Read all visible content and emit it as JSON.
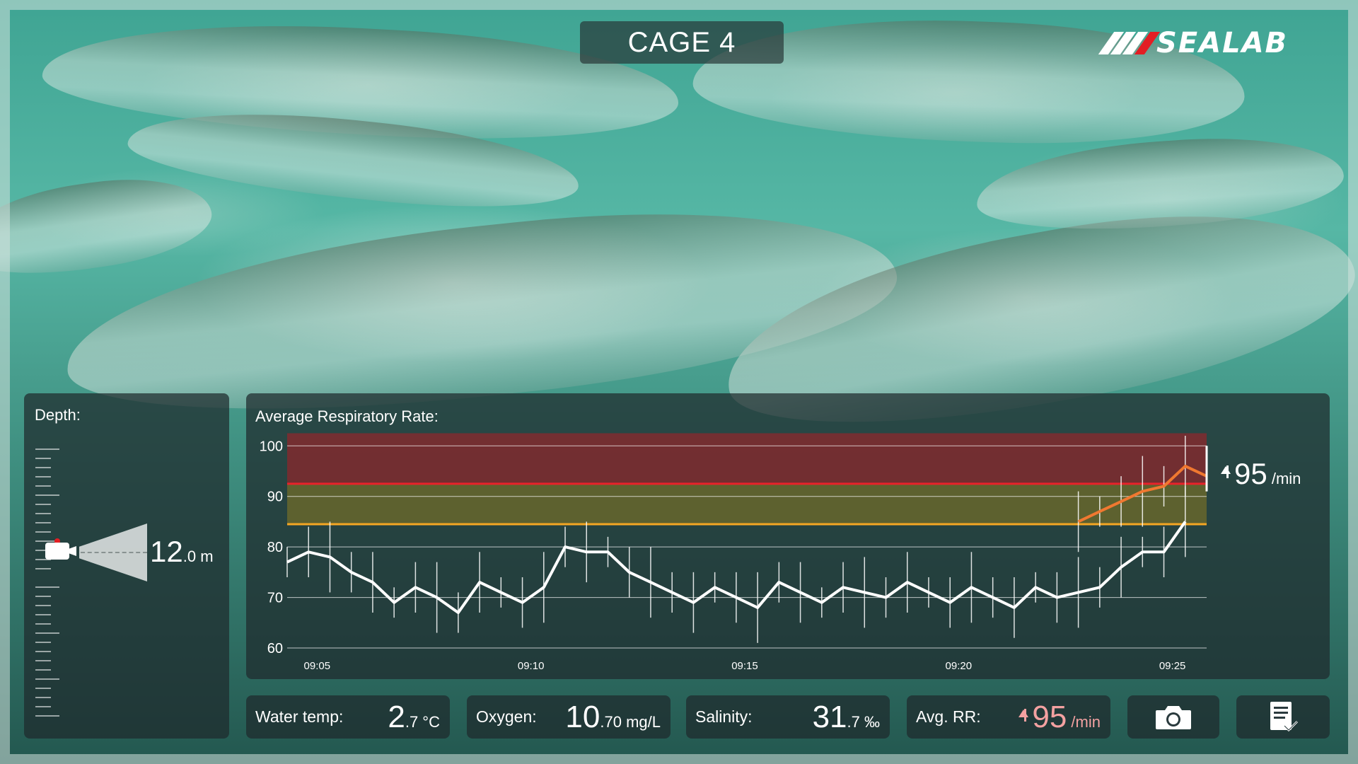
{
  "title": "CAGE 4",
  "brand": {
    "name": "SEALAB",
    "accent": "#e31e24"
  },
  "depth": {
    "label": "Depth:",
    "value_int": "12",
    "value_dec": ".0",
    "unit": " m",
    "camera_icon": "camera-icon"
  },
  "chart": {
    "title": "Average Respiratory Rate:",
    "current": {
      "value": "95",
      "unit": " /min"
    }
  },
  "chart_data": {
    "type": "line",
    "title": "Average Respiratory Rate:",
    "ylim": [
      60,
      102
    ],
    "yticks": [
      "60",
      "70",
      "80",
      "90",
      "100"
    ],
    "xticks": [
      "09:05",
      "09:10",
      "09:15",
      "09:20",
      "09:25"
    ],
    "xlim_minutes": [
      0,
      21.5
    ],
    "xtick_minutes": [
      0.7,
      5.7,
      10.7,
      15.7,
      20.7
    ],
    "thresholds": [
      {
        "name": "alarm",
        "value": 92.5,
        "color": "#e8232a"
      },
      {
        "name": "warning",
        "value": 84.5,
        "color": "#f5a623"
      }
    ],
    "bands": [
      {
        "from": 92.5,
        "to": 102.5,
        "color": "#b01b22"
      },
      {
        "from": 84.5,
        "to": 92.5,
        "color": "#8a7a20"
      }
    ],
    "grid": true,
    "series": [
      {
        "x": [
          0,
          0.5,
          1,
          1.5,
          2,
          2.5,
          3,
          3.5,
          4,
          4.5,
          5,
          5.5,
          6,
          6.5,
          7,
          7.5,
          8,
          8.5,
          9,
          9.5,
          10,
          10.5,
          11,
          11.5,
          12,
          12.5,
          13,
          13.5,
          14,
          14.5,
          15,
          15.5,
          16,
          16.5,
          17,
          17.5,
          18,
          18.5,
          19,
          19.5,
          20,
          20.5,
          21
        ],
        "values": [
          77,
          79,
          78,
          75,
          73,
          69,
          72,
          70,
          67,
          73,
          71,
          69,
          72,
          80,
          79,
          79,
          75,
          73,
          71,
          69,
          72,
          70,
          68,
          73,
          71,
          69,
          72,
          71,
          70,
          73,
          71,
          69,
          72,
          70,
          68,
          72,
          70,
          71,
          72,
          76,
          79,
          79,
          85
        ],
        "color": "#ffffff"
      },
      {
        "x": [
          18.5,
          19,
          19.5,
          20,
          20.5,
          21,
          21.5
        ],
        "values": [
          85,
          87,
          89,
          91,
          92,
          96,
          94
        ],
        "color": "#f07830"
      }
    ]
  },
  "stats": {
    "water_temp": {
      "label": "Water temp:",
      "int": "2",
      "dec": ".7",
      "unit": " °C"
    },
    "oxygen": {
      "label": "Oxygen:",
      "int": "10",
      "dec": ".70",
      "unit": " mg/L"
    },
    "salinity": {
      "label": "Salinity:",
      "int": "31",
      "dec": ".7",
      "unit": " ‰"
    },
    "avg_rr": {
      "label": "Avg. RR:",
      "value": "95",
      "unit": " /min",
      "color": "#f0a0a0"
    }
  },
  "buttons": {
    "camera_icon": "camera-icon",
    "report_icon": "report-checklist-icon"
  }
}
